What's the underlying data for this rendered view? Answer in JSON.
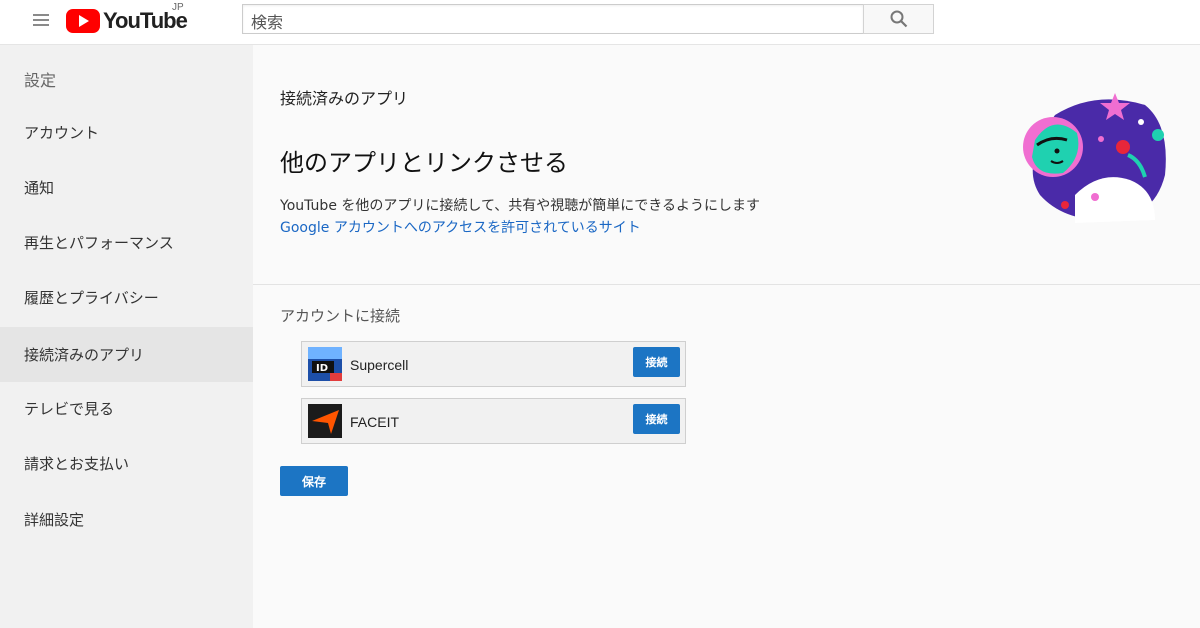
{
  "header": {
    "logo_text": "YouTube",
    "logo_country": "JP",
    "search_placeholder": "検索",
    "icons": {
      "menu": "hamburger-menu-icon",
      "search": "search-icon",
      "logo": "youtube-play-icon"
    }
  },
  "sidebar": {
    "heading": "設定",
    "items": [
      {
        "label": "アカウント",
        "active": false
      },
      {
        "label": "通知",
        "active": false
      },
      {
        "label": "再生とパフォーマンス",
        "active": false
      },
      {
        "label": "履歴とプライバシー",
        "active": false
      },
      {
        "label": "接続済みのアプリ",
        "active": true
      },
      {
        "label": "テレビで見る",
        "active": false
      },
      {
        "label": "請求とお支払い",
        "active": false
      },
      {
        "label": "詳細設定",
        "active": false
      }
    ]
  },
  "main": {
    "subtitle": "接続済みのアプリ",
    "title": "他のアプリとリンクさせる",
    "description": "YouTube を他のアプリに接続して、共有や視聴が簡単にできるようにします",
    "link": "Google アカウントへのアクセスを許可されているサイト",
    "connect_heading": "アカウントに接続",
    "apps": [
      {
        "name": "Supercell",
        "button": "接続",
        "icon": "supercell-id-icon"
      },
      {
        "name": "FACEIT",
        "button": "接続",
        "icon": "faceit-icon"
      }
    ],
    "save_label": "保存"
  },
  "colors": {
    "brand_red": "#ff0000",
    "accent_blue": "#1c75c4",
    "link_blue": "#1a67c4",
    "sidebar_bg": "#f1f1f1",
    "active_item_bg": "#e5e5e5"
  }
}
